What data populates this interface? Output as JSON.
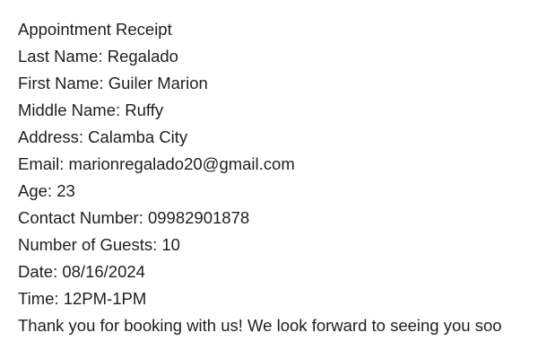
{
  "receipt": {
    "title": "Appointment Receipt",
    "last_name": "Last Name: Regalado",
    "first_name": "First Name: Guiler Marion",
    "middle_name": "Middle Name: Ruffy",
    "address": "Address: Calamba City",
    "email": "Email: marionregalado20@gmail.com",
    "age": "Age: 23",
    "contact_number": "Contact Number: 09982901878",
    "guests": "Number of Guests: 10",
    "date": "Date: 08/16/2024",
    "time": "Time: 12PM-1PM",
    "thank_you": "Thank you for booking with us! We look forward to seeing you soo"
  }
}
